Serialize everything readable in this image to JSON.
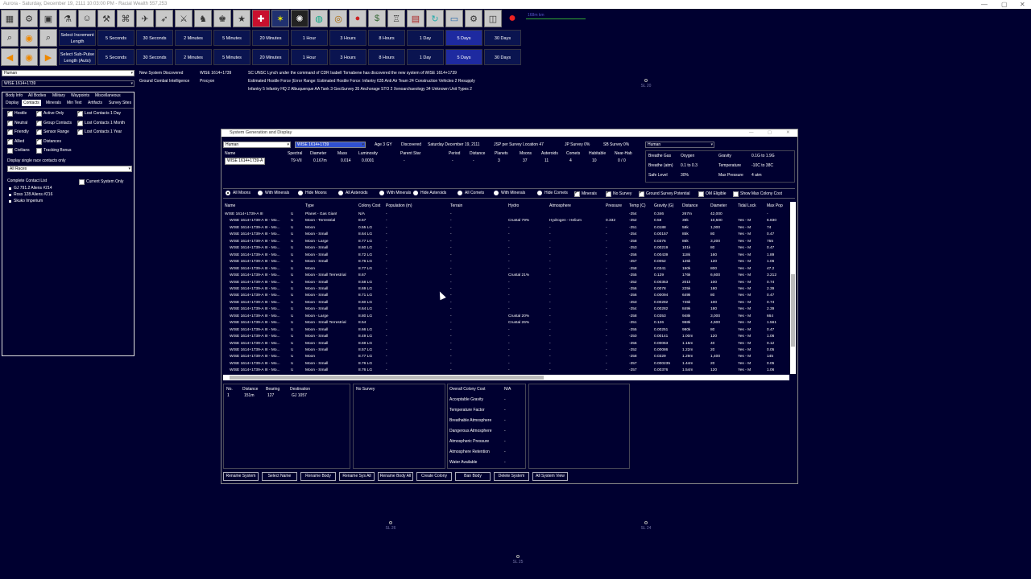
{
  "window": {
    "title": "Aurora - Saturday, December 19, 2111 10:03:00 PM - Racial Wealth 557,253",
    "min": "—",
    "max": "▢",
    "close": "✕"
  },
  "toolbar": {
    "inc_label": "Select Increment Length",
    "sub_label": "Select Sub-Pulse Length (Auto)",
    "increments": [
      "5 Seconds",
      "30 Seconds",
      "2 Minutes",
      "5 Minutes",
      "20 Minutes",
      "1 Hour",
      "3 Hours",
      "8 Hours",
      "1 Day",
      "5 Days",
      "30 Days"
    ],
    "selected_increment": "5 Days",
    "scale": "168m km"
  },
  "left": {
    "race_select": "Human",
    "system_select": "WISE 1614+1739",
    "tabs_row1": [
      "Body Info",
      "All Bodies",
      "Military",
      "Waypoints",
      "Miscellaneous"
    ],
    "tabs_row2": [
      "Display",
      "Contacts",
      "Minerals",
      "Min Text",
      "Artifacts",
      "Survey Sites"
    ],
    "checks_col1": [
      {
        "l": "Hostile",
        "on": true
      },
      {
        "l": "Neutral",
        "on": true
      },
      {
        "l": "Friendly",
        "on": true
      },
      {
        "l": "Allied",
        "on": true
      },
      {
        "l": "Civilians",
        "on": false
      }
    ],
    "checks_col2": [
      {
        "l": "Active Only",
        "on": true
      },
      {
        "l": "Group Contacts",
        "on": true
      },
      {
        "l": "Sensor Range",
        "on": true
      },
      {
        "l": "Distances",
        "on": true
      },
      {
        "l": "Tracking Bonus",
        "on": false
      }
    ],
    "checks_col3": [
      {
        "l": "Lost Contacts 1 Day",
        "on": true
      },
      {
        "l": "Lost Contacts 1 Month",
        "on": true
      },
      {
        "l": "Lost Contacts 1 Year",
        "on": true
      }
    ],
    "single_race_label": "Display single race contacts only",
    "race_filter": "All Races",
    "contact_list_label": "Complete Contact List",
    "current_only": "Current System Only",
    "contacts": [
      "GJ 791.2 Aliens #214",
      "Ross 128 Aliens #216",
      "Skuko Imperium"
    ]
  },
  "events": {
    "lines": [
      {
        "a": "New System Discovered",
        "b": "WISE 1614+1739",
        "c": "SC UNSC Lynch under the command of CDR Isabell Tornabene has discovered the new system of WISE 1614+1739"
      },
      {
        "a": "Ground Combat Intelligence",
        "b": "Procyon",
        "c": "Estimated Hostile Force (Error Range:   Estimated Hostile Force:  Infantry 635  Anti Air Team 24  Construction Vehicles 2  Resupply"
      },
      {
        "a": "",
        "b": "",
        "c": "Infantry 5  Infantry HQ 2  Albuquerque  AA Tank 3  GeoSurvey 35  Anchorage  STO 2  Xenoarchaeology 34  Unknown Unit Types 2"
      }
    ]
  },
  "sysgen": {
    "title": "System Generation and Display",
    "race": "Human",
    "system": "WISE 1614+1739",
    "age": "Age  3 GY",
    "discovered_label": "Discovered",
    "discovered": "Saturday  December 19, 2111",
    "jsp": "JSP per Survey Location   47",
    "jp_survey": "JP Survey   0%",
    "sb_survey": "SB Survey   0%",
    "race2": "Human",
    "star_headers": [
      "Name",
      "Spectral",
      "Diameter",
      "Mass",
      "Luminosity",
      "Parent Star",
      "Period",
      "Distance",
      "Planets",
      "Moons",
      "Asteroids",
      "Comets",
      "Habitable",
      "Near-Hab"
    ],
    "star_values": [
      "WISE 1614+1739-A",
      "T9-VII",
      "0.167m",
      "0.014",
      "0.0001",
      "-",
      "-",
      "-",
      "3",
      "37",
      "11",
      "4",
      "10",
      "0 / 0"
    ],
    "env": {
      "breathe_gas_l": "Breathe Gas",
      "breathe_gas": "Oxygen",
      "gravity_l": "Gravity",
      "gravity": "0.1G  to  1.9G",
      "breathe_atm_l": "Breathe (atm)",
      "breathe_atm": "0.1  to  0.3",
      "temp_l": "Temperature",
      "temp": "-10C  to  38C",
      "safe_l": "Safe Level",
      "safe": "30%",
      "maxp_l": "Max Pressure",
      "maxp": "4 atm"
    },
    "filters": [
      {
        "l": "All Moons",
        "on": true
      },
      {
        "l": "With Minerals",
        "on": false
      },
      {
        "l": "Hide Moons",
        "on": false
      },
      {
        "l": "All Asteroids",
        "on": false
      },
      {
        "l": "With Minerals",
        "on": false
      },
      {
        "l": "Hide Asteroids",
        "on": false
      },
      {
        "l": "All Comets",
        "on": false
      },
      {
        "l": "With Minerals",
        "on": false
      },
      {
        "l": "Hide Comets",
        "on": false
      }
    ],
    "flags": [
      {
        "l": "Minerals",
        "on": true
      },
      {
        "l": "No Survey",
        "on": true
      },
      {
        "l": "Ground Survey Potential",
        "on": true
      },
      {
        "l": "OM Eligible",
        "on": false
      },
      {
        "l": "Show Max Colony Cost",
        "on": false
      }
    ],
    "columns": [
      "Name",
      "Type",
      "Colony Cost",
      "Population (m)",
      "Terrain",
      "Hydro",
      "Atmosphere",
      "Pressure",
      "Temp (C)",
      "Gravity (G)",
      "Distance",
      "Diameter",
      "Tidal Lock",
      "Max Pop"
    ],
    "rows": [
      [
        "WISE 1614+1739-A III",
        "U",
        "Planet - Gas Giant",
        "N/A",
        "-",
        "-",
        "",
        "",
        "",
        "-254",
        "0.346",
        "267m",
        "42,000",
        "",
        "-"
      ],
      [
        "WISE 1614+1739-A III - Mo...",
        "U",
        "Moon - Terrestrial",
        "8.57",
        "-",
        "-",
        "Crustal 79%",
        "Hydrogen - Helium",
        "0.332",
        "-252",
        "0.58",
        "39k",
        "10,500",
        "Yes - M",
        "6.830"
      ],
      [
        "WISE 1614+1739-A III - Mo...",
        "U",
        "Moon",
        "0.55 LG",
        "-",
        "-",
        "-",
        "-",
        "-",
        "-251",
        "0.0188",
        "58k",
        "1,000",
        "Yes - M",
        "74"
      ],
      [
        "WISE 1614+1739-A III - Mo...",
        "U",
        "Moon - Small",
        "8.64 LG",
        "-",
        "-",
        "-",
        "-",
        "-",
        "-254",
        "0.00157",
        "85k",
        "80",
        "Yes - M",
        "0.47"
      ],
      [
        "WISE 1614+1739-A III - Mo...",
        "U",
        "Moon - Large",
        "8.77 LG",
        "-",
        "-",
        "-",
        "-",
        "-",
        "-258",
        "0.0376",
        "86k",
        "3,200",
        "Yes - M",
        "755"
      ],
      [
        "WISE 1614+1739-A III - Mo...",
        "U",
        "Moon - Small",
        "8.60 LG",
        "-",
        "-",
        "-",
        "-",
        "-",
        "-253",
        "0.00219",
        "101k",
        "80",
        "Yes - M",
        "0.47"
      ],
      [
        "WISE 1614+1739-A III - Mo...",
        "U",
        "Moon - Small",
        "8.72 LG",
        "-",
        "-",
        "-",
        "-",
        "-",
        "-256",
        "0.00439",
        "118k",
        "160",
        "Yes - M",
        "1.89"
      ],
      [
        "WISE 1614+1739-A III - Mo...",
        "U",
        "Moon - Small",
        "8.76 LG",
        "-",
        "-",
        "-",
        "-",
        "-",
        "-257",
        "0.0052",
        "125k",
        "120",
        "Yes - M",
        "1.06"
      ],
      [
        "WISE 1614+1739-A III - Mo...",
        "U",
        "Moon",
        "8.77 LG",
        "-",
        "-",
        "-",
        "-",
        "-",
        "-258",
        "0.0341",
        "150k",
        "800",
        "Yes - M",
        "47.2"
      ],
      [
        "WISE 1614+1739-A III - Mo...",
        "U",
        "Moon - Small Terrestrial",
        "8.67",
        "-",
        "-",
        "Crustal 21%",
        "-",
        "-",
        "-255",
        "0.129",
        "176k",
        "6,600",
        "Yes - M",
        "3.212"
      ],
      [
        "WISE 1614+1739-A III - Mo...",
        "U",
        "Moon - Small",
        "8.58 LG",
        "-",
        "-",
        "-",
        "-",
        "-",
        "-252",
        "0.00353",
        "201k",
        "100",
        "Yes - M",
        "0.74"
      ],
      [
        "WISE 1614+1739-A III - Mo...",
        "U",
        "Moon - Small",
        "8.69 LG",
        "-",
        "-",
        "-",
        "-",
        "-",
        "-256",
        "0.0078",
        "225k",
        "180",
        "Yes - M",
        "2.39"
      ],
      [
        "WISE 1614+1739-A III - Mo...",
        "U",
        "Moon - Small",
        "8.71 LG",
        "-",
        "-",
        "-",
        "-",
        "-",
        "-256",
        "0.00094",
        "649k",
        "80",
        "Yes - M",
        "0.47"
      ],
      [
        "WISE 1614+1739-A III - Mo...",
        "U",
        "Moon - Small",
        "8.60 LG",
        "-",
        "-",
        "-",
        "-",
        "-",
        "-253",
        "0.00282",
        "745k",
        "100",
        "Yes - M",
        "0.74"
      ],
      [
        "WISE 1614+1739-A III - Mo...",
        "U",
        "Moon - Small",
        "8.64 LG",
        "-",
        "-",
        "-",
        "-",
        "-",
        "-254",
        "0.00282",
        "849k",
        "180",
        "Yes - M",
        "2.39"
      ],
      [
        "WISE 1614+1739-A III - Mo...",
        "U",
        "Moon - Large",
        "8.80 LG",
        "-",
        "-",
        "Crustal 20%",
        "-",
        "-",
        "-258",
        "0.0353",
        "948k",
        "3,000",
        "Yes - M",
        "664"
      ],
      [
        "WISE 1614+1739-A III - Mo...",
        "U",
        "Moon - Small Terrestrial",
        "8.54",
        "-",
        "-",
        "Crustal 26%",
        "-",
        "-",
        "-251",
        "0.126",
        "968k",
        "4,600",
        "Yes - M",
        "1.561"
      ],
      [
        "WISE 1614+1739-A III - Mo...",
        "U",
        "Moon - Small",
        "8.66 LG",
        "-",
        "-",
        "-",
        "-",
        "-",
        "-255",
        "0.00251",
        "980k",
        "80",
        "Yes - M",
        "0.47"
      ],
      [
        "WISE 1614+1739-A III - Mo...",
        "U",
        "Moon - Small",
        "8.49 LG",
        "-",
        "-",
        "-",
        "-",
        "-",
        "-250",
        "0.00141",
        "1.00m",
        "120",
        "Yes - M",
        "1.06"
      ],
      [
        "WISE 1614+1739-A III - Mo...",
        "U",
        "Moon - Small",
        "8.69 LG",
        "-",
        "-",
        "-",
        "-",
        "-",
        "-256",
        "0.00063",
        "1.15m",
        "40",
        "Yes - M",
        "0.12"
      ],
      [
        "WISE 1614+1739-A III - Mo...",
        "U",
        "Moon - Small",
        "8.57 LG",
        "-",
        "-",
        "-",
        "-",
        "-",
        "-252",
        "0.00086",
        "1.22m",
        "20",
        "Yes - M",
        "0.05"
      ],
      [
        "WISE 1614+1739-A III - Mo...",
        "U",
        "Moon",
        "8.77 LG",
        "-",
        "-",
        "-",
        "-",
        "-",
        "-258",
        "0.0329",
        "1.29m",
        "1,400",
        "Yes - M",
        "145"
      ],
      [
        "WISE 1614+1739-A III - Mo...",
        "U",
        "Moon - Small",
        "8.76 LG",
        "-",
        "-",
        "-",
        "-",
        "-",
        "-257",
        "0.000235",
        "1.44m",
        "20",
        "Yes - M",
        "0.05"
      ],
      [
        "WISE 1614+1739-A III - Mo...",
        "U",
        "Moon - Small",
        "8.76 LG",
        "-",
        "-",
        "-",
        "-",
        "-",
        "-257",
        "0.00376",
        "1.54m",
        "120",
        "Yes - M",
        "1.06"
      ]
    ],
    "jp_headers": [
      "No.",
      "Distance",
      "Bearing",
      "Destination"
    ],
    "jp_row": [
      "1",
      "151m",
      "127",
      "GJ 1057"
    ],
    "no_survey": "No Survey",
    "colony_labels": [
      "Overall Colony Cost",
      "Acceptable Gravity",
      "Temperature Factor",
      "Breathable Atmosphere",
      "Dangerous Atmosphere",
      "Atmospheric Pressure",
      "Atmosphere Retention",
      "Water Available"
    ],
    "colony_values": [
      "N/A",
      "-",
      "-",
      "-",
      "-",
      "-",
      "-",
      "-"
    ],
    "buttons": [
      "Rename System",
      "Select Name",
      "Rename Body",
      "Rename Sys All",
      "Rename Body All",
      "Create Colony",
      "Ban Body",
      "Delete System",
      "All System View"
    ]
  },
  "map_labels": [
    "SL 20",
    "SL 26",
    "SL 24",
    "SL 25"
  ]
}
